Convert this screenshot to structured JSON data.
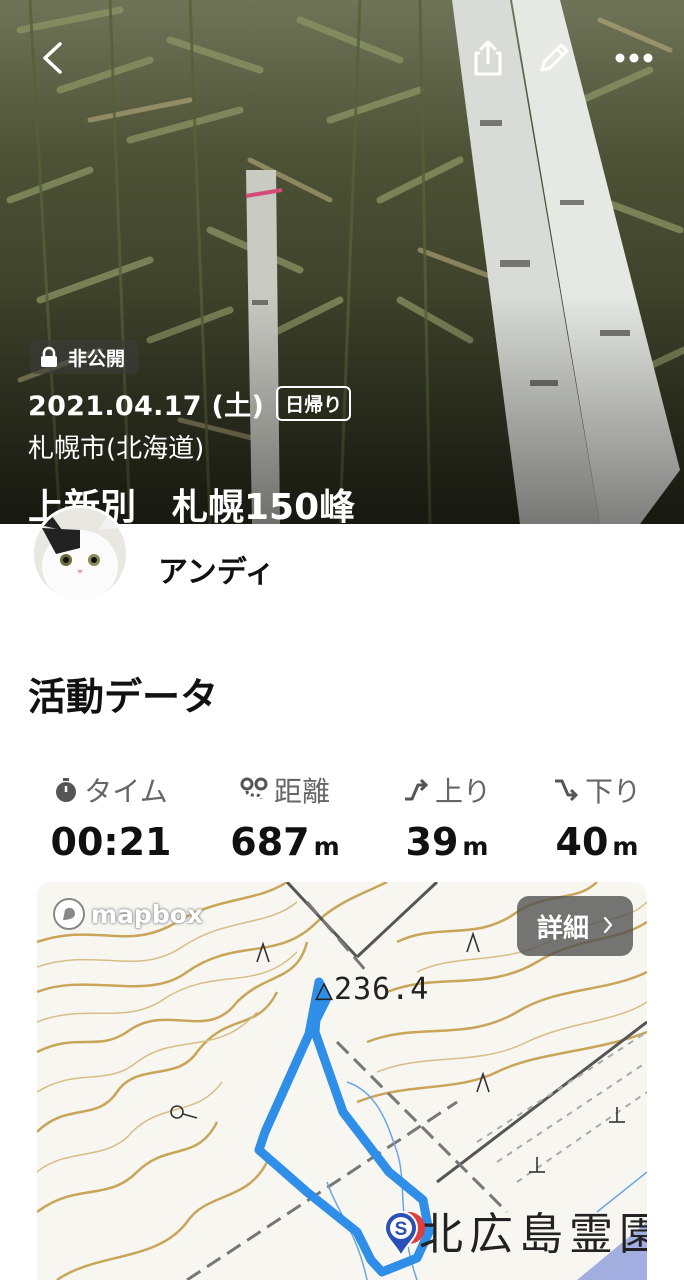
{
  "header": {
    "back_icon": "chevron-left-icon",
    "share_icon": "share-icon",
    "edit_icon": "pencil-icon",
    "more_icon": "more-dots-icon"
  },
  "hero": {
    "privacy": "非公開",
    "date": "2021.04.17 (土)",
    "trip_type": "日帰り",
    "location": "札幌市(北海道)",
    "title": "上新別　札幌150峰"
  },
  "user": {
    "name": "アンディ"
  },
  "activity": {
    "section_title": "活動データ",
    "stats": [
      {
        "label": "タイム",
        "value": "00:21",
        "unit": "",
        "icon": "stopwatch-icon"
      },
      {
        "label": "距離",
        "value": "687",
        "unit": "m",
        "icon": "route-icon"
      },
      {
        "label": "上り",
        "value": "39",
        "unit": "m",
        "icon": "ascent-icon"
      },
      {
        "label": "下り",
        "value": "40",
        "unit": "m",
        "icon": "descent-icon"
      }
    ]
  },
  "map": {
    "attribution": "mapbox",
    "details_label": "詳細",
    "elevation_label": "△236.4",
    "place_label": "北広島霊園",
    "start_marker": "S",
    "route_color": "#2f8ee8"
  }
}
